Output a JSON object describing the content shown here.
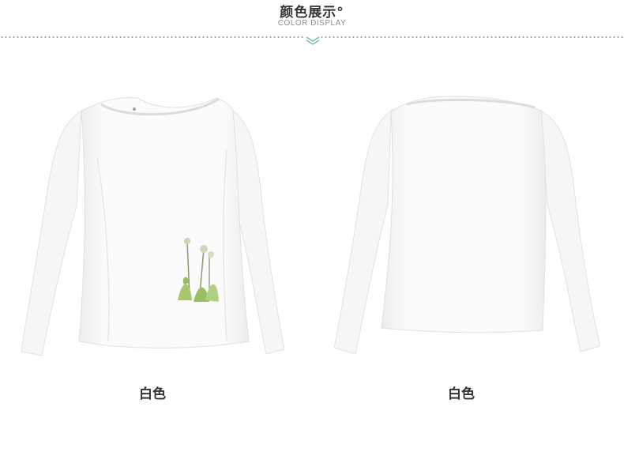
{
  "header": {
    "title": "颜色展示°",
    "subtitle": "COLOR DISPLAY",
    "accent_color": "#5fb3a8"
  },
  "products": [
    {
      "color_label": "白色",
      "view": "front"
    },
    {
      "color_label": "白色",
      "view": "back"
    }
  ]
}
